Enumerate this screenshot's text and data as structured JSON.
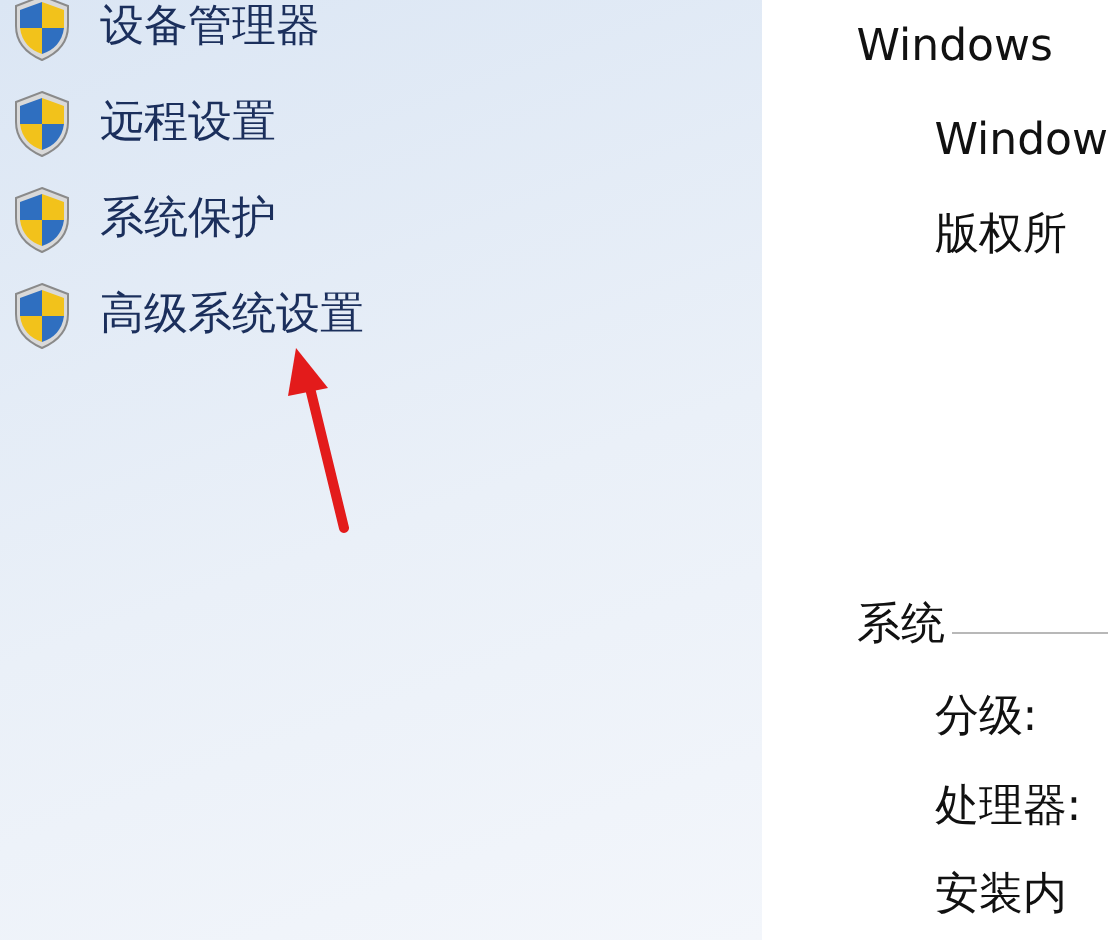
{
  "sidebar": {
    "items": [
      {
        "label": "设备管理器"
      },
      {
        "label": "远程设置"
      },
      {
        "label": "系统保护"
      },
      {
        "label": "高级系统设置"
      }
    ]
  },
  "annotation": {
    "kind": "arrow"
  },
  "main": {
    "edition_heading": "Windows",
    "edition_lines": [
      "Window",
      "版权所"
    ],
    "system_section": {
      "title": "系统",
      "labels": [
        "分级:",
        "处理器:",
        "安装内"
      ]
    }
  }
}
